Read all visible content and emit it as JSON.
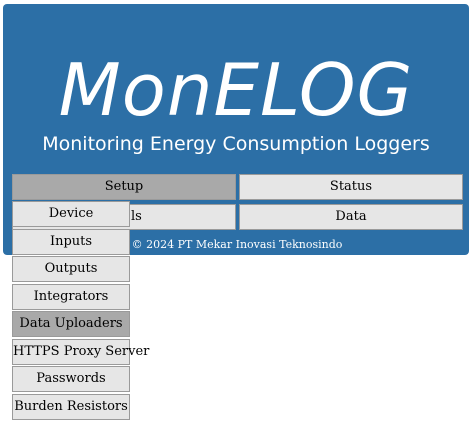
{
  "header": {
    "logo": "MonELOG",
    "subtitle": "Monitoring Energy Consumption Loggers",
    "copyright": "© 2024 PT Mekar Inovasi Teknosindo"
  },
  "nav": {
    "setup": "Setup",
    "status": "Status",
    "tools_partial": "ls",
    "data": "Data"
  },
  "setup_menu": {
    "items": [
      "Device",
      "Inputs",
      "Outputs",
      "Integrators",
      "Data Uploaders",
      "HTTPS Proxy Server",
      "Passwords",
      "Burden Resistors"
    ],
    "highlighted": "Data Uploaders"
  },
  "colors": {
    "header_bg": "#2c6fa6",
    "button_bg": "#e6e6e6",
    "button_active_bg": "#a9a9a9"
  }
}
